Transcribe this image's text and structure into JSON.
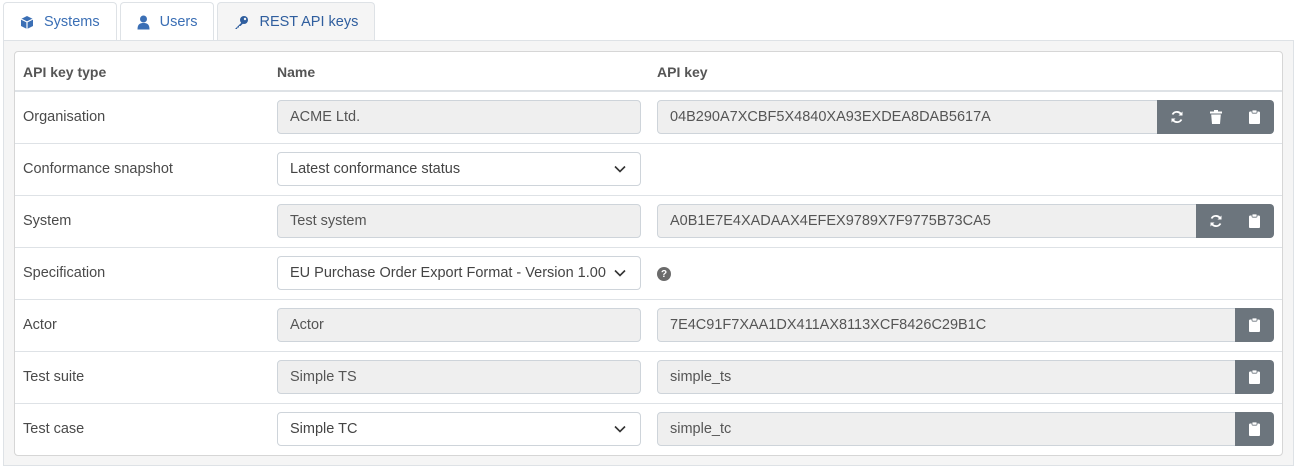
{
  "tabs": [
    {
      "label": "Systems",
      "icon": "cube-icon"
    },
    {
      "label": "Users",
      "icon": "user-icon"
    },
    {
      "label": "REST API keys",
      "icon": "key-icon",
      "active": true
    }
  ],
  "table": {
    "headers": {
      "type": "API key type",
      "name": "Name",
      "key": "API key"
    },
    "rows": [
      {
        "type": "Organisation",
        "name": "ACME Ltd.",
        "name_kind": "readonly",
        "key": "04B290A7XCBF5X4840XA93EXDEA8DAB5617A",
        "actions": [
          "refresh-icon",
          "trash-icon",
          "clipboard-icon"
        ]
      },
      {
        "type": "Conformance snapshot",
        "name": "Latest conformance status",
        "name_kind": "select"
      },
      {
        "type": "System",
        "name": "Test system",
        "name_kind": "readonly",
        "key": "A0B1E7E4XADAAX4EFEX9789X7F9775B73CA5",
        "actions": [
          "refresh-icon",
          "clipboard-icon"
        ]
      },
      {
        "type": "Specification",
        "name": "EU Purchase Order Export Format - Version 1.00",
        "name_kind": "select",
        "help": "?"
      },
      {
        "type": "Actor",
        "name": "Actor",
        "name_kind": "readonly",
        "key": "7E4C91F7XAA1DX411AX8113XCF8426C29B1C",
        "actions": [
          "clipboard-icon"
        ]
      },
      {
        "type": "Test suite",
        "name": "Simple TS",
        "name_kind": "readonly",
        "key": "simple_ts",
        "actions": [
          "clipboard-icon"
        ]
      },
      {
        "type": "Test case",
        "name": "Simple TC",
        "name_kind": "select",
        "key": "simple_tc",
        "actions": [
          "clipboard-icon"
        ]
      }
    ]
  },
  "colors": {
    "tab_link": "#3b6fb5",
    "button": "#6c757d",
    "readonly_bg": "#efefef"
  }
}
